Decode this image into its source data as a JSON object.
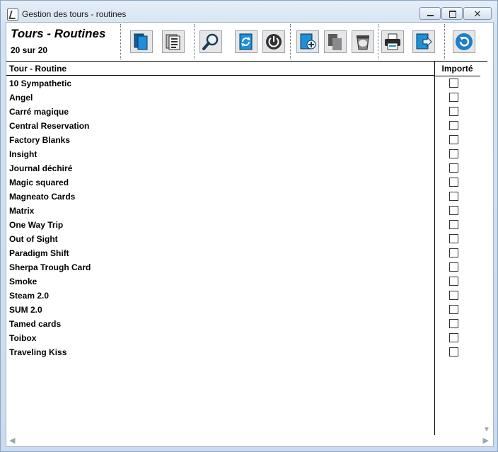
{
  "window": {
    "title": "Gestion des tours - routines",
    "minimize_label": "–",
    "maximize_label": "□",
    "close_label": "✕"
  },
  "header": {
    "title": "Tours - Routines",
    "count": "20 sur 20"
  },
  "toolbar": [
    {
      "name": "cards-icon",
      "color": "#1e7fc8"
    },
    {
      "name": "list-icon",
      "color": "#555555"
    },
    {
      "name": "search-icon",
      "color": "#1e7fc8"
    },
    {
      "name": "refresh-icon",
      "color": "#1e7fc8"
    },
    {
      "name": "power-icon",
      "color": "#333333"
    },
    {
      "name": "add-icon",
      "color": "#1e7fc8"
    },
    {
      "name": "copy-icon",
      "color": "#777777"
    },
    {
      "name": "delete-icon",
      "color": "#777777"
    },
    {
      "name": "print-icon",
      "color": "#1e7fc8"
    },
    {
      "name": "export-icon",
      "color": "#1e7fc8"
    },
    {
      "name": "undo-icon",
      "color": "#1e7fc8"
    }
  ],
  "table": {
    "columns": [
      "Tour - Routine",
      "Importé"
    ],
    "rows": [
      {
        "name": "10 Sympathetic",
        "imported": false
      },
      {
        "name": "Angel",
        "imported": false
      },
      {
        "name": "Carré magique",
        "imported": false
      },
      {
        "name": "Central Reservation",
        "imported": false
      },
      {
        "name": "Factory Blanks",
        "imported": false
      },
      {
        "name": "Insight",
        "imported": false
      },
      {
        "name": "Journal déchiré",
        "imported": false
      },
      {
        "name": "Magic squared",
        "imported": false
      },
      {
        "name": "Magneato Cards",
        "imported": false
      },
      {
        "name": "Matrix",
        "imported": false
      },
      {
        "name": "One Way Trip",
        "imported": false
      },
      {
        "name": "Out of Sight",
        "imported": false
      },
      {
        "name": "Paradigm Shift",
        "imported": false
      },
      {
        "name": "Sherpa Trough Card",
        "imported": false
      },
      {
        "name": "Smoke",
        "imported": false
      },
      {
        "name": "Steam 2.0",
        "imported": false
      },
      {
        "name": "SUM 2.0",
        "imported": false
      },
      {
        "name": "Tamed cards",
        "imported": false
      },
      {
        "name": "Toibox",
        "imported": false
      },
      {
        "name": "Traveling Kiss",
        "imported": false
      }
    ]
  }
}
